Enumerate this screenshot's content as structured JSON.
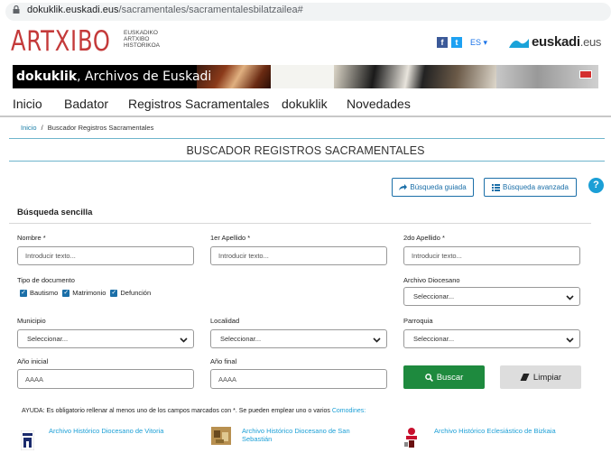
{
  "browser": {
    "url_host": "dokuklik.euskadi.eus",
    "url_path": "/sacramentales/sacramentalesbilatzailea#"
  },
  "header": {
    "logo_text": "ARTXIBO",
    "logo_sub": [
      "EUSKADIKO",
      "ARTXIBO",
      "HISTORIKOA"
    ],
    "lang": "ES",
    "euskadi_brand": "euskadi",
    "euskadi_suffix": ".eus"
  },
  "banner": {
    "title_bold": "dokuklik",
    "title_rest": ", Archivos de Euskadi"
  },
  "nav": {
    "items": [
      "Inicio",
      "Badator",
      "Registros Sacramentales",
      "dokuklik",
      "Novedades"
    ]
  },
  "breadcrumb": {
    "home": "Inicio",
    "separator": "/",
    "current": "Buscador Registros Sacramentales"
  },
  "page_title": "BUSCADOR REGISTROS SACRAMENTALES",
  "actions": {
    "guided": "Búsqueda guiada",
    "advanced": "Búsqueda avanzada",
    "help": "?"
  },
  "section_title": "Búsqueda sencilla",
  "form": {
    "nombre_label": "Nombre *",
    "apellido1_label": "1er Apellido *",
    "apellido2_label": "2do Apellido *",
    "text_placeholder": "Introducir texto...",
    "tipo_label": "Tipo de documento",
    "checkboxes": [
      "Bautismo",
      "Matrimonio",
      "Defunción"
    ],
    "archivo_label": "Archivo Diocesano",
    "municipio_label": "Municipio",
    "localidad_label": "Localidad",
    "parroquia_label": "Parroquia",
    "select_placeholder": "Seleccionar...",
    "anio_inicial_label": "Año inicial",
    "anio_final_label": "Año final",
    "year_placeholder": "AAAA",
    "buscar": "Buscar",
    "limpiar": "Limpiar"
  },
  "help_text": {
    "text": "AYUDA: Es obligatorio rellenar al menos uno de los campos marcados con *. Se pueden emplear uno o varios",
    "link": "Comodines:"
  },
  "archives": [
    {
      "name": "Archivo Histórico Diocesano de Vitoria"
    },
    {
      "name_line1": "Archivo Histórico Diocesano de San",
      "name_line2": "Sebastián"
    },
    {
      "name": "Archivo Histórico Eclesiástico de Bizkaia"
    }
  ],
  "colors": {
    "logo": "#c43a3a",
    "link": "#1b9fd6",
    "primary": "#1b6fa8",
    "search_button": "#1e8a3e"
  }
}
